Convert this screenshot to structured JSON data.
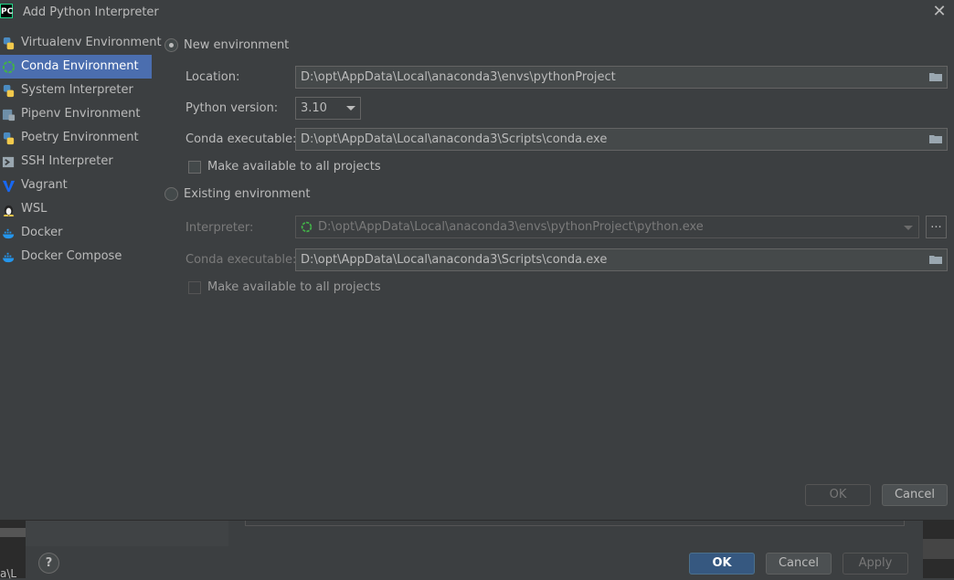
{
  "window": {
    "title": "Add Python Interpreter",
    "app_logo": "PC",
    "close_icon": "close-icon"
  },
  "sidebar": {
    "items": [
      {
        "label": "Virtualenv Environment",
        "icon": "python-icon",
        "selected": false
      },
      {
        "label": "Conda Environment",
        "icon": "conda-icon",
        "selected": true
      },
      {
        "label": "System Interpreter",
        "icon": "python-icon",
        "selected": false
      },
      {
        "label": "Pipenv Environment",
        "icon": "pipenv-icon",
        "selected": false
      },
      {
        "label": "Poetry Environment",
        "icon": "poetry-icon",
        "selected": false
      },
      {
        "label": "SSH Interpreter",
        "icon": "terminal-icon",
        "selected": false
      },
      {
        "label": "Vagrant",
        "icon": "vagrant-icon",
        "selected": false
      },
      {
        "label": "WSL",
        "icon": "linux-icon",
        "selected": false
      },
      {
        "label": "Docker",
        "icon": "docker-icon",
        "selected": false
      },
      {
        "label": "Docker Compose",
        "icon": "docker-icon",
        "selected": false
      }
    ]
  },
  "new_env": {
    "radio_label": "New environment",
    "selected": true,
    "location_label": "Location:",
    "location_value": "D:\\opt\\AppData\\Local\\anaconda3\\envs\\pythonProject",
    "python_version_label": "Python version:",
    "python_version_value": "3.10",
    "conda_exec_label": "Conda executable:",
    "conda_exec_value": "D:\\opt\\AppData\\Local\\anaconda3\\Scripts\\conda.exe",
    "make_available_label": "Make available to all projects"
  },
  "existing_env": {
    "radio_label": "Existing environment",
    "selected": false,
    "interpreter_label": "Interpreter:",
    "interpreter_value": "D:\\opt\\AppData\\Local\\anaconda3\\envs\\pythonProject\\python.exe",
    "ellipsis_label": "...",
    "conda_exec_label": "Conda executable:",
    "conda_exec_value": "D:\\opt\\AppData\\Local\\anaconda3\\Scripts\\conda.exe",
    "make_available_label": "Make available to all projects"
  },
  "buttons": {
    "ok": "OK",
    "cancel": "Cancel"
  },
  "parent_dialog": {
    "help": "?",
    "ok": "OK",
    "cancel": "Cancel",
    "apply": "Apply",
    "fragment_text": "a\\L"
  },
  "colors": {
    "accent": "#4b6eaf",
    "background": "#3c3f41",
    "primary_button": "#365880"
  }
}
